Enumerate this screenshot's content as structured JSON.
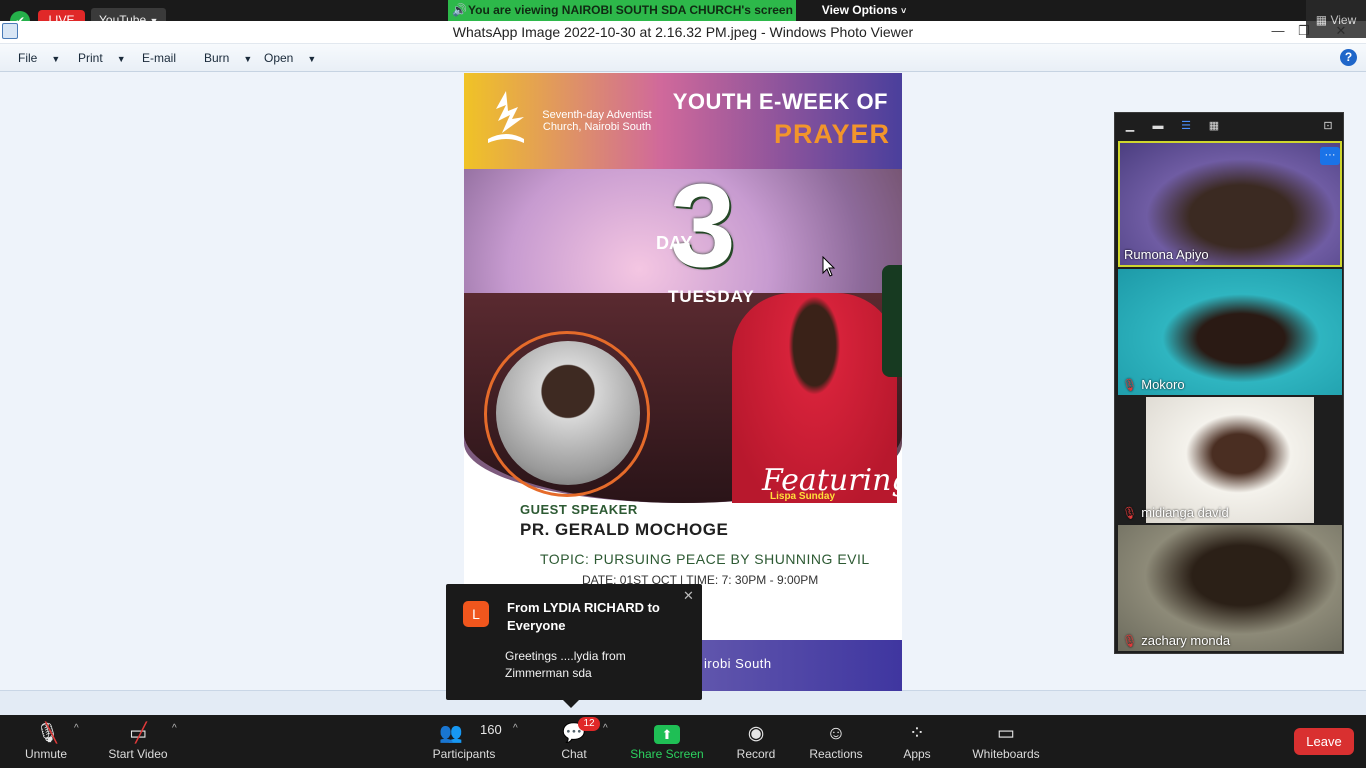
{
  "zoom_top": {
    "live_label": "LIVE",
    "stream_target": "YouTube",
    "viewing_banner": "You are viewing NAIROBI SOUTH SDA CHURCH's screen",
    "view_options_label": "View Options",
    "view_label": "View"
  },
  "photo_viewer": {
    "window_title": "WhatsApp Image 2022-10-30 at 2.16.32 PM.jpeg - Windows Photo Viewer",
    "menu": {
      "file": "File",
      "print": "Print",
      "email": "E-mail",
      "burn": "Burn",
      "open": "Open"
    },
    "help_glyph": "?"
  },
  "poster": {
    "church_name": "Seventh-day Adventist Church, Nairobi South",
    "headline_1": "YOUTH E-WEEK OF",
    "headline_2": "PRAYER",
    "day_label": "DAY",
    "day_number": "3",
    "weekday": "TUESDAY",
    "featuring_label": "Featuring",
    "featured_name": "Lispa Sunday",
    "guest_speaker_label": "GUEST SPEAKER",
    "guest_speaker_name": "PR. GERALD MOCHOGE",
    "topic": "TOPIC: PURSUING PEACE BY SHUNNING EVIL",
    "date_time": "DATE: 01ST OCT | TIME: 7: 30PM - 9:00PM",
    "footer_text": "irobi South"
  },
  "gallery": {
    "participants": [
      {
        "name": "Rumona Apiyo",
        "muted": false
      },
      {
        "name": "Mokoro",
        "muted": true
      },
      {
        "name": "midianga david",
        "muted": true
      },
      {
        "name": "zachary monda",
        "muted": true
      }
    ]
  },
  "chat_notification": {
    "avatar_letter": "L",
    "from": "From LYDIA RICHARD to Everyone",
    "message": "Greetings ....lydia from Zimmerman sda"
  },
  "toolbar": {
    "unmute": "Unmute",
    "start_video": "Start Video",
    "participants": "Participants",
    "participant_count": "160",
    "chat": "Chat",
    "chat_unread": "12",
    "share_screen": "Share Screen",
    "record": "Record",
    "reactions": "Reactions",
    "apps": "Apps",
    "whiteboards": "Whiteboards",
    "leave": "Leave"
  }
}
